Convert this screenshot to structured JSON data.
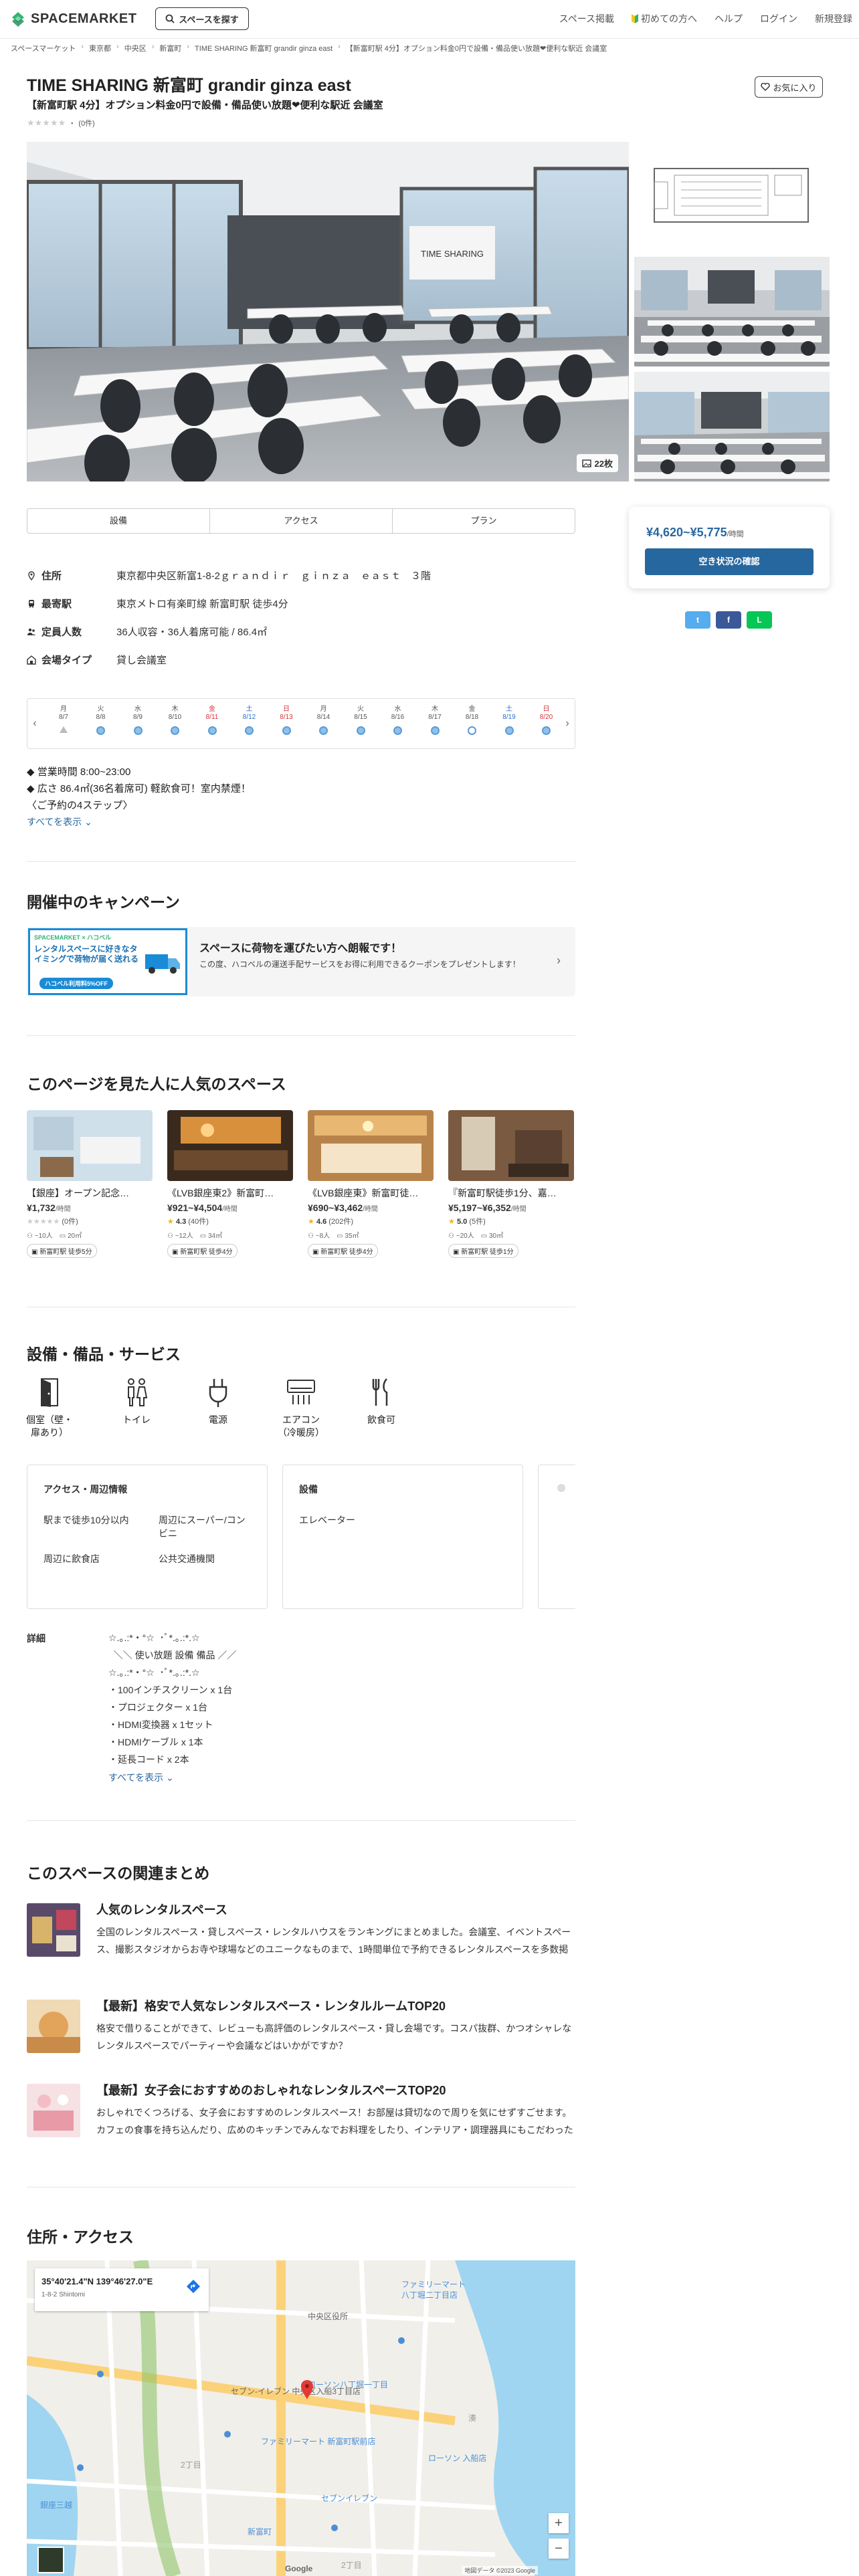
{
  "header": {
    "logo": "SPACEMARKET",
    "search_label": "スペースを探す",
    "nav": [
      "スペース掲載",
      "初めての方へ",
      "ヘルプ",
      "ログイン",
      "新規登録"
    ]
  },
  "breadcrumb": [
    "スペースマーケット",
    "東京都",
    "中央区",
    "新富町",
    "TIME SHARING 新富町 grandir ginza east",
    "【新富町駅 4分】オプション料金0円で設備・備品使い放題❤便利な駅近 会議室"
  ],
  "listing": {
    "title": "TIME SHARING 新富町 grandir ginza east",
    "subtitle": "【新富町駅 4分】オプション料金0円で設備・備品使い放題❤便利な駅近 会議室",
    "stars": "★★★★★",
    "review_count": "(0件)",
    "favorite_label": "お気に入り",
    "photo_count": "22枚",
    "screen_text": "TIME SHARING"
  },
  "tabs": [
    "設備",
    "アクセス",
    "プラン"
  ],
  "booking": {
    "price": "¥4,620~¥5,775",
    "unit": "/時間",
    "button": "空き状況の確認"
  },
  "share": [
    "t",
    "f",
    "L"
  ],
  "info": [
    {
      "label": "住所",
      "value": "東京都中央区新富1-8-2ｇｒａｎｄｉｒ　ｇｉｎｚａ　ｅａｓｔ　３階",
      "icon": "pin-icon"
    },
    {
      "label": "最寄駅",
      "value": "東京メトロ有楽町線 新富町駅 徒歩4分",
      "icon": "train-icon"
    },
    {
      "label": "定員人数",
      "value": "36人収容・36人着席可能 / 86.4㎡",
      "icon": "people-icon"
    },
    {
      "label": "会場タイプ",
      "value": "貸し会議室",
      "icon": "building-icon"
    }
  ],
  "calendar": [
    {
      "dow": "月",
      "date": "8/7",
      "status": "closed"
    },
    {
      "dow": "火",
      "date": "8/8",
      "status": "available"
    },
    {
      "dow": "水",
      "date": "8/9",
      "status": "available"
    },
    {
      "dow": "木",
      "date": "8/10",
      "status": "available"
    },
    {
      "dow": "金",
      "date": "8/11",
      "status": "available",
      "holiday": true
    },
    {
      "dow": "土",
      "date": "8/12",
      "status": "available",
      "weekend": "sat"
    },
    {
      "dow": "日",
      "date": "8/13",
      "status": "available",
      "weekend": "sun"
    },
    {
      "dow": "月",
      "date": "8/14",
      "status": "available"
    },
    {
      "dow": "火",
      "date": "8/15",
      "status": "available"
    },
    {
      "dow": "水",
      "date": "8/16",
      "status": "available"
    },
    {
      "dow": "木",
      "date": "8/17",
      "status": "available"
    },
    {
      "dow": "金",
      "date": "8/18",
      "status": "partial"
    },
    {
      "dow": "土",
      "date": "8/19",
      "status": "available",
      "weekend": "sat"
    },
    {
      "dow": "日",
      "date": "8/20",
      "status": "available",
      "weekend": "sun"
    }
  ],
  "description": {
    "lines": [
      "◆ 営業時間 8:00~23:00",
      "◆ 広さ 86.4㎡(36名着席可) 軽飲食可！室内禁煙！",
      "〈ご予約の4ステップ〉"
    ],
    "more": "すべてを表示"
  },
  "campaign": {
    "heading": "開催中のキャンペーン",
    "banner_brand": "SPACEMARKET × ハコベル",
    "banner_text": "レンタルスペースに好きなタイミングで荷物が届く送れる",
    "banner_badge": "ハコベル利用料5%OFF",
    "title": "スペースに荷物を運びたい方へ朗報です！",
    "text": "この度、ハコベルの運送手配サービスをお得に利用できるクーポンをプレゼントします！"
  },
  "popular": {
    "heading": "このページを見た人に人気のスペース",
    "items": [
      {
        "name": "【銀座】オープン記念…",
        "price": "¥1,732",
        "unit": "/時間",
        "rating": "",
        "reviews": "(0件)",
        "capacity": "~10人",
        "area": "20㎡",
        "station": "新富町駅 徒歩5分"
      },
      {
        "name": "《LVB銀座東2》新富町…",
        "price": "¥921~¥4,504",
        "unit": "/時間",
        "rating": "4.3",
        "reviews": "(40件)",
        "capacity": "~12人",
        "area": "34㎡",
        "station": "新富町駅 徒歩4分"
      },
      {
        "name": "《LVB銀座東》新富町徒…",
        "price": "¥690~¥3,462",
        "unit": "/時間",
        "rating": "4.6",
        "reviews": "(202件)",
        "capacity": "~8人",
        "area": "35㎡",
        "station": "新富町駅 徒歩4分"
      },
      {
        "name": "『新富町駅徒歩1分、嘉…",
        "price": "¥5,197~¥6,352",
        "unit": "/時間",
        "rating": "5.0",
        "reviews": "(5件)",
        "capacity": "~20人",
        "area": "30㎡",
        "station": "新富町駅 徒歩1分"
      }
    ]
  },
  "amenities": {
    "heading": "設備・備品・サービス",
    "icons": [
      {
        "label": "個室（壁・扉あり）",
        "icon": "door-icon"
      },
      {
        "label": "トイレ",
        "icon": "toilet-icon"
      },
      {
        "label": "電源",
        "icon": "plug-icon"
      },
      {
        "label": "エアコン（冷暖房）",
        "icon": "aircon-icon"
      },
      {
        "label": "飲食可",
        "icon": "cutlery-icon"
      }
    ],
    "access_title": "アクセス・周辺情報",
    "access_items": [
      "駅まで徒歩10分以内",
      "周辺にスーパー/コンビニ",
      "周辺に飲食店",
      "公共交通機関"
    ],
    "equip_title": "設備",
    "equip_items": [
      "エレベーター"
    ]
  },
  "detail": {
    "label": "詳細",
    "text": "☆.｡.:*・°☆  ･ﾟ*.｡.:*.☆\n  ＼＼ 使い放題 設備 備品 ／／\n☆.｡.:*・°☆  ･ﾟ*.｡.:*.☆\n・100インチスクリーン x 1台\n・プロジェクター x 1台\n・HDMI変換器 x 1セット\n・HDMIケーブル x 1本\n・延長コード x 2本",
    "more": "すべてを表示"
  },
  "related": {
    "heading": "このスペースの関連まとめ",
    "items": [
      {
        "title": "人気のレンタルスペース",
        "desc": "全国のレンタルスペース・貸しスペース・レンタルハウスをランキングにまとめました。会議室、イベントスペース、撮影スタジオからお寺や球場などのユニークなものまで、1時間単位で予約できるレンタルスペースを多数掲載しています。都道府県、市区町村、駅などのエリアでランキングをさ…"
      },
      {
        "title": "【最新】格安で人気なレンタルスペース・レンタルルームTOP20",
        "desc": "格安で借りることができて、レビューも高評価のレンタルスペース・貸し会場です。コスパ抜群、かつオシャレなレンタルスペースでパーティーや会議などはいかがですか？"
      },
      {
        "title": "【最新】女子会におすすめのおしゃれなレンタルスペースTOP20",
        "desc": "おしゃれでくつろげる、女子会におすすめのレンタルスペース！お部屋は貸切なので周りを気にせずすごせます。カフェの食事を持ち込んだり、広めのキッチンでみんなでお料理をしたり、インテリア・調理器具にもこだわったスペースも多数掲載。特別な場所でいつもとは一味違う時間をお過…"
      }
    ]
  },
  "map": {
    "heading": "住所・アクセス",
    "coords": "35°40'21.4\"N 139°46'27.0\"E",
    "sub": "1-8-2 Shintomi",
    "copyright": "地図データ ©2023 Google",
    "labels": [
      "ファミリーマート",
      "八丁堀二丁目店",
      "ローソン八丁堀一丁目",
      "ファミリーマート 新富町駅前店",
      "セブンイレブン",
      "ローソン 入船店",
      "2丁目",
      "銀座三越",
      "湊",
      "中央区役所",
      "新富町",
      "セブン-イレブン 中央区入船3丁目店"
    ],
    "zoom_in": "+",
    "zoom_out": "−",
    "google": "Google"
  },
  "colors": {
    "accent": "#27679f",
    "brand_green": "#2fb674",
    "line": "#06c755",
    "facebook": "#3b5998",
    "twitter": "#55acee"
  }
}
